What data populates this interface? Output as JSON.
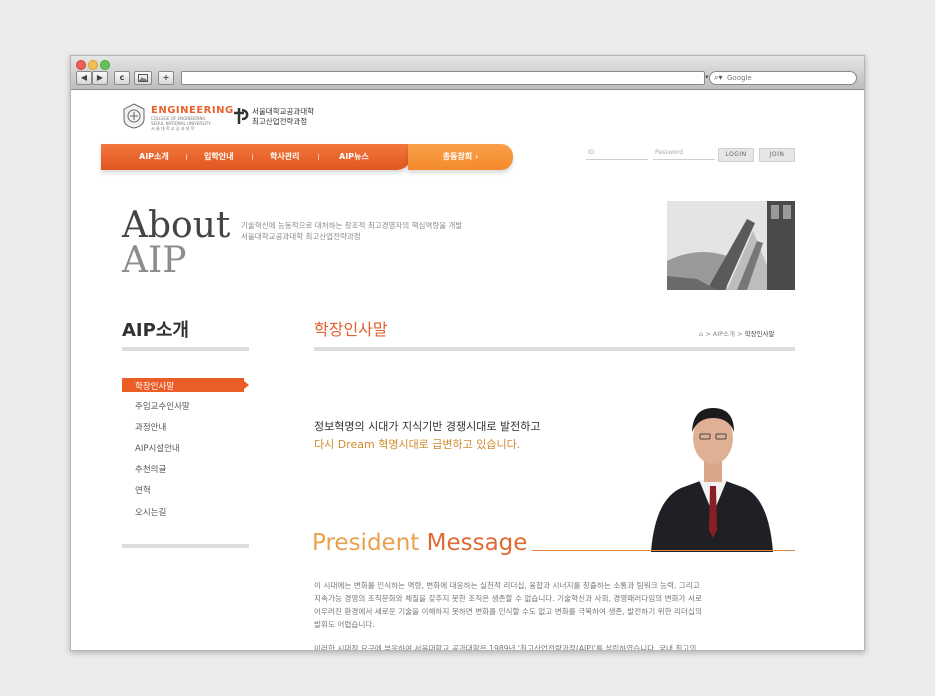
{
  "browser": {
    "nav_back": "◀",
    "nav_forward": "▶",
    "reload": "c",
    "add": "+",
    "search_placeholder": "Google"
  },
  "header": {
    "logo_en": "ENGINEERING",
    "logo_en_sub1": "COLLEGE OF ENGINEERING",
    "logo_en_sub2": "SEOUL NATIONAL UNIVERSITY",
    "logo_en_sub3": "서 울 대 학 교 공 과 대 학",
    "logo_kr_line1": "서울대학교공과대학",
    "logo_kr_line2": "최고산업전략과정"
  },
  "nav": {
    "items": [
      "AIP소개",
      "입학안내",
      "학사관리",
      "AIP뉴스"
    ],
    "alumni": "총동창회 ›"
  },
  "login": {
    "id_placeholder": "ID",
    "password_placeholder": "Password",
    "login_label": "LOGIN",
    "join_label": "JOIN"
  },
  "hero": {
    "title_line1": "About",
    "title_line2": "AIP",
    "desc_line1": "기술혁신에 능동적으로 대처하는 창조적 최고경영자의 핵심역량을 개발",
    "desc_line2": "서울대학교공과대학 최고산업전략과정"
  },
  "sidebar": {
    "title": "AIP소개",
    "items": [
      "학장인사말",
      "주임교수인사말",
      "과정안내",
      "AIP시설안내",
      "추천의글",
      "연혁",
      "오시는길"
    ]
  },
  "content": {
    "title": "학장인사말",
    "breadcrumb": {
      "home": "⌂",
      "sep1": ">",
      "level1": "AIP소개",
      "sep2": ">",
      "current": "학장인사말"
    },
    "headline1": "정보혁명의 시대가 지식기반 경쟁시대로 발전하고",
    "headline2": "다시 Dream 혁명시대로 급변하고 있습니다.",
    "section_title_a": "President ",
    "section_title_b": "Message",
    "paragraph1": [
      "이 시대에는 변화를 인식하는 역량, 변화에 대응하는 실천적 리더십, 융합과 시너지를 창출하는 소통과 팀워크 능력, 그리고",
      "지속가능 경영의 조직문화와 체질을 갖추지 못한 조직은 생존할 수 없습니다. 기술혁신과 사회, 경영패러다임의 변화가 서로",
      "어우러진 환경에서 새로운 기술을 이해하지 못하면 변화를 인식할 수도 없고 변화를 극복하여 생존, 발전하기 위한 리더십의",
      "발휘도 어렵습니다."
    ],
    "paragraph2": "이러한 시대적 요구에 부응하여 서울대학교 공과대학은 1989년 '최고산업전략과정(AIP)'를 설립하였습니다. 국내 최고의"
  },
  "colors": {
    "accent": "#e7622c",
    "accent_gold": "#d08a2a",
    "alumni": "#f6922f"
  }
}
